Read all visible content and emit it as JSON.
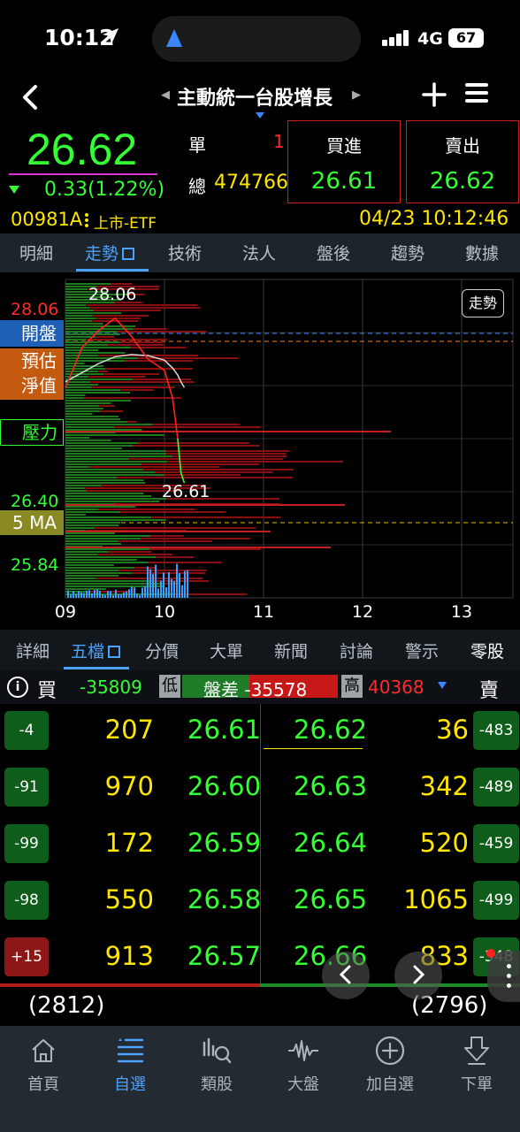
{
  "status_bar": {
    "time": "10:12",
    "network": "4G",
    "battery": "67"
  },
  "header": {
    "title": "主動統一台股增長"
  },
  "quote": {
    "price": "26.62",
    "change": "0.33(1.22%)",
    "single_label": "單",
    "single_value": "1",
    "total_label": "總",
    "total_value": "474766",
    "buy_label": "買進",
    "buy_price": "26.61",
    "sell_label": "賣出",
    "sell_price": "26.62",
    "code": "00981A",
    "market": "上市-ETF",
    "datetime": "04/23 10:12:46"
  },
  "main_tabs": [
    {
      "label": "明細"
    },
    {
      "label": "走勢"
    },
    {
      "label": "技術"
    },
    {
      "label": "法人"
    },
    {
      "label": "盤後"
    },
    {
      "label": "趨勢"
    },
    {
      "label": "數據"
    }
  ],
  "chart": {
    "button": "走勢",
    "price_labels": {
      "high": "28.06",
      "mid": "26.40",
      "low": "25.84"
    },
    "tags": {
      "open": "開盤",
      "estimate_line1": "預估",
      "estimate_line2": "淨值",
      "pressure": "壓力",
      "ma": "5 MA"
    },
    "annotations": {
      "max": "28.06",
      "last": "26.61"
    },
    "x_labels": [
      "09",
      "10",
      "11",
      "12",
      "13"
    ]
  },
  "chart_data": {
    "type": "line",
    "x": [
      "09:00",
      "09:10",
      "09:20",
      "09:30",
      "09:40",
      "09:50",
      "10:00",
      "10:05",
      "10:08",
      "10:10",
      "10:12"
    ],
    "series": [
      {
        "values": [
          27.45,
          27.8,
          27.95,
          28.06,
          27.9,
          27.7,
          27.6,
          27.35,
          27.0,
          26.7,
          26.61
        ]
      },
      {
        "values": [
          27.5,
          27.58,
          27.66,
          27.72,
          27.74,
          27.73,
          27.69,
          27.62,
          27.56,
          27.5,
          27.45
        ]
      }
    ],
    "xlabel": "",
    "ylabel": "",
    "ylim": [
      25.6,
      28.4
    ],
    "x_ticks": [
      "09",
      "10",
      "11",
      "12",
      "13"
    ],
    "y_ticks": [
      "28.06",
      "26.40",
      "25.84"
    ],
    "grid": true,
    "colors": {
      "price": "#ff2020",
      "average": "#d8d8d8",
      "price_after": "#33ff33"
    }
  },
  "book_tabs": [
    {
      "label": "詳細"
    },
    {
      "label": "五檔"
    },
    {
      "label": "分價"
    },
    {
      "label": "大單"
    },
    {
      "label": "新聞"
    },
    {
      "label": "討論"
    },
    {
      "label": "警示"
    },
    {
      "label": "零股"
    }
  ],
  "summary": {
    "buy_label": "買",
    "buy_diff": "-35809",
    "low_label": "低",
    "diff_label": "盤差",
    "diff_value": "-35578",
    "high_label": "高",
    "high_value": "40368",
    "sell_label": "賣"
  },
  "order_book": [
    {
      "bid_badge": "-4",
      "bid_qty": "207",
      "bid_price": "26.61",
      "ask_price": "26.62",
      "ask_qty": "36",
      "ask_badge": "-483"
    },
    {
      "bid_badge": "-91",
      "bid_qty": "970",
      "bid_price": "26.60",
      "ask_price": "26.63",
      "ask_qty": "342",
      "ask_badge": "-489"
    },
    {
      "bid_badge": "-99",
      "bid_qty": "172",
      "bid_price": "26.59",
      "ask_price": "26.64",
      "ask_qty": "520",
      "ask_badge": "-459"
    },
    {
      "bid_badge": "-98",
      "bid_qty": "550",
      "bid_price": "26.58",
      "ask_price": "26.65",
      "ask_qty": "1065",
      "ask_badge": "-499"
    },
    {
      "bid_badge": "+15",
      "bid_qty": "913",
      "bid_price": "26.57",
      "ask_price": "26.66",
      "ask_qty": "833",
      "ask_badge": "-348"
    }
  ],
  "totals": {
    "buy": "(2812)",
    "sell": "(2796)"
  },
  "bottom_nav": [
    {
      "label": "首頁",
      "icon": "home-icon"
    },
    {
      "label": "自選",
      "icon": "watchlist-icon"
    },
    {
      "label": "類股",
      "icon": "sector-icon"
    },
    {
      "label": "大盤",
      "icon": "market-pulse-icon"
    },
    {
      "label": "加自選",
      "icon": "add-circle-icon"
    },
    {
      "label": "下單",
      "icon": "order-icon"
    }
  ]
}
